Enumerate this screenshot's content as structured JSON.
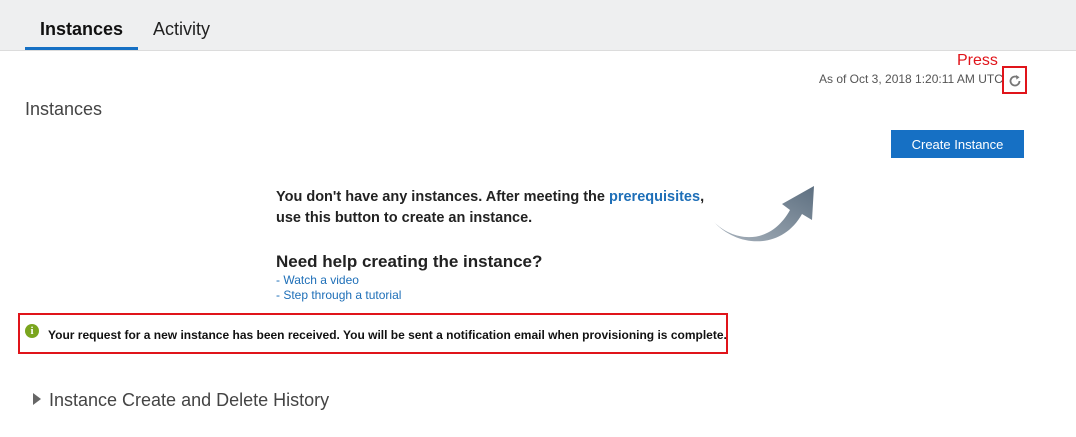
{
  "tabs": [
    {
      "label": "Instances",
      "active": true
    },
    {
      "label": "Activity",
      "active": false
    }
  ],
  "annotation": {
    "press_label": "Press"
  },
  "status": {
    "as_of": "As of Oct 3, 2018 1:20:11 AM UTC"
  },
  "section": {
    "title": "Instances"
  },
  "create_button": {
    "label": "Create Instance"
  },
  "empty_state": {
    "line1_prefix": "You don't have any instances. After meeting the ",
    "line1_link": "prerequisites",
    "line1_suffix": ",",
    "line2": "use this button to create an instance."
  },
  "help": {
    "title": "Need help creating the instance?",
    "links": [
      "- Watch a video",
      "- Step through a tutorial"
    ]
  },
  "notice": {
    "text": "Your request for a new instance has been received. You will be sent a notification email when provisioning is complete.",
    "icon": "info-icon"
  },
  "history": {
    "label": "Instance Create and Delete History"
  },
  "colors": {
    "accent": "#1670c4",
    "link": "#1e6fb8",
    "highlight": "#e0141a",
    "info": "#7aa51e"
  }
}
